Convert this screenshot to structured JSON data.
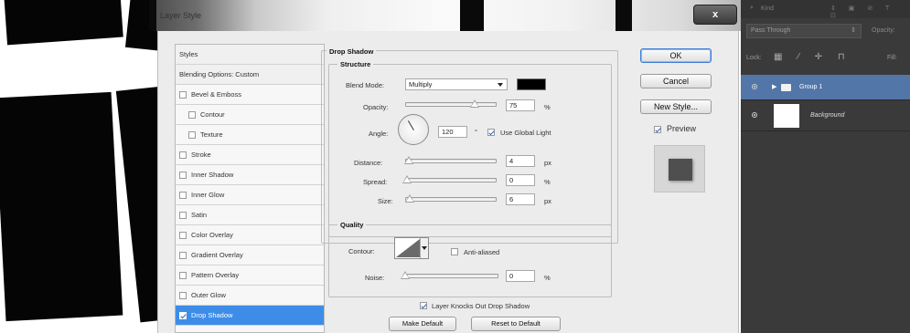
{
  "dialog_title": "Layer Style",
  "close_label": "x",
  "styles_list": {
    "header": "Styles",
    "blending": "Blending Options: Custom",
    "items": [
      {
        "label": "Bevel & Emboss",
        "checked": false,
        "indent": false
      },
      {
        "label": "Contour",
        "checked": false,
        "indent": true
      },
      {
        "label": "Texture",
        "checked": false,
        "indent": true
      },
      {
        "label": "Stroke",
        "checked": false,
        "indent": false
      },
      {
        "label": "Inner Shadow",
        "checked": false,
        "indent": false
      },
      {
        "label": "Inner Glow",
        "checked": false,
        "indent": false
      },
      {
        "label": "Satin",
        "checked": false,
        "indent": false
      },
      {
        "label": "Color Overlay",
        "checked": false,
        "indent": false
      },
      {
        "label": "Gradient Overlay",
        "checked": false,
        "indent": false
      },
      {
        "label": "Pattern Overlay",
        "checked": false,
        "indent": false
      },
      {
        "label": "Outer Glow",
        "checked": false,
        "indent": false
      },
      {
        "label": "Drop Shadow",
        "checked": true,
        "indent": false,
        "selected": true
      }
    ]
  },
  "drop_shadow": {
    "section_title": "Drop Shadow",
    "structure_title": "Structure",
    "blend_mode_label": "Blend Mode:",
    "blend_mode_value": "Multiply",
    "shadow_color": "#000000",
    "opacity_label": "Opacity:",
    "opacity_value": "75",
    "opacity_unit": "%",
    "opacity_level": 0.75,
    "angle_label": "Angle:",
    "angle_value": "120",
    "angle_unit": "°",
    "use_global_light": "Use Global Light",
    "use_global_light_checked": true,
    "distance_label": "Distance:",
    "distance_value": "4",
    "distance_unit": "px",
    "spread_label": "Spread:",
    "spread_value": "0",
    "spread_unit": "%",
    "size_label": "Size:",
    "size_value": "6",
    "size_unit": "px"
  },
  "quality": {
    "title": "Quality",
    "contour_label": "Contour:",
    "anti_aliased": "Anti-aliased",
    "noise_label": "Noise:",
    "noise_value": "0",
    "noise_unit": "%",
    "layer_knocks": "Layer Knocks Out Drop Shadow",
    "make_default": "Make Default",
    "reset_default": "Reset to Default"
  },
  "buttons": {
    "ok": "OK",
    "cancel": "Cancel",
    "new_style": "New Style...",
    "preview": "Preview",
    "preview_checked": true
  },
  "layers_panel": {
    "kind_label": "Kind",
    "blend_mode": "Pass Through",
    "opacity_label": "Opacity:",
    "lock_label": "Lock:",
    "fill_label": "Fill:",
    "layers": [
      {
        "name": "Group 1",
        "selected": true,
        "type": "folder"
      },
      {
        "name": "Background",
        "selected": false,
        "type": "image"
      }
    ],
    "selected_color": "#5276a8",
    "panel_color": "#3a3a3a"
  }
}
